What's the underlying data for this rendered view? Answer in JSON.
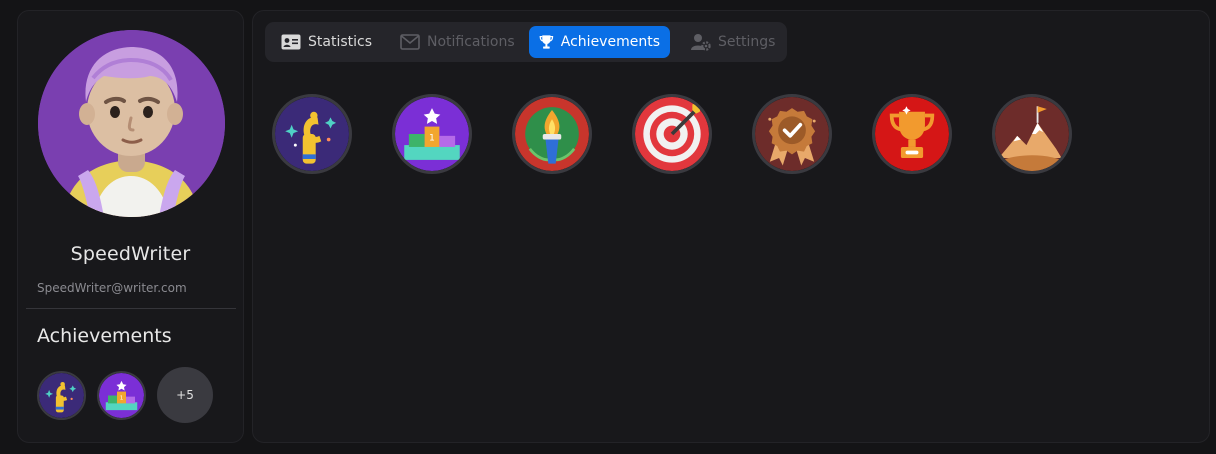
{
  "profile": {
    "username": "SpeedWriter",
    "email": "SpeedWriter@writer.com",
    "achievements_title": "Achievements",
    "more_count": "+5",
    "avatar_bg": "#7a3fb0"
  },
  "tabs": [
    {
      "label": "Statistics",
      "icon": "id-card-icon",
      "state": "normal"
    },
    {
      "label": "Notifications",
      "icon": "envelope-icon",
      "state": "disabled"
    },
    {
      "label": "Achievements",
      "icon": "trophy-icon",
      "state": "active"
    },
    {
      "label": "Settings",
      "icon": "user-gear-icon",
      "state": "disabled"
    }
  ],
  "badges": [
    {
      "icon": "hand-coin-badge-icon",
      "bg": "#3b2a78"
    },
    {
      "icon": "podium-star-badge-icon",
      "bg": "#7b2fd6"
    },
    {
      "icon": "torch-badge-icon",
      "bg": "#c8352c"
    },
    {
      "icon": "target-arrow-badge-icon",
      "bg": "#e8e8e8"
    },
    {
      "icon": "ribbon-check-badge-icon",
      "bg": "#6d2c2a"
    },
    {
      "icon": "trophy-badge-icon",
      "bg": "#d51616"
    },
    {
      "icon": "mountain-flag-badge-icon",
      "bg": "#6d2c2a"
    }
  ],
  "colors": {
    "accent": "#0a6fe6",
    "background": "#141416",
    "panel": "#18181b"
  }
}
